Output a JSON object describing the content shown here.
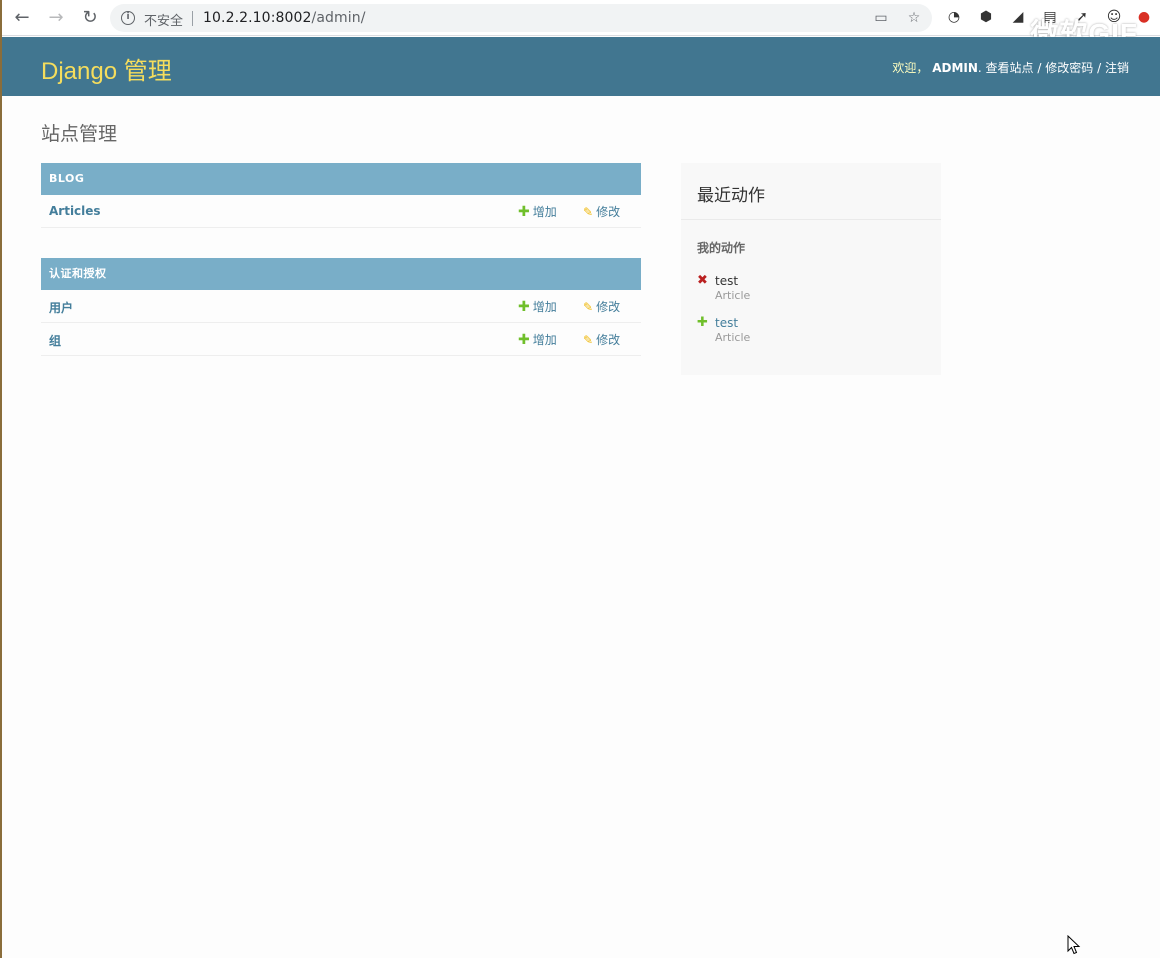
{
  "browser": {
    "security_label": "不安全",
    "url_host": "10.2.2.10:8002",
    "url_path": "/admin/",
    "watermark": "微软GIF"
  },
  "header": {
    "branding": "Django 管理",
    "welcome": "欢迎，",
    "username": "ADMIN",
    "view_site": "查看站点",
    "change_password": "修改密码",
    "logout": "注销",
    "separator": "/"
  },
  "page_title": "站点管理",
  "modules": [
    {
      "caption": "BLOG",
      "rows": [
        {
          "name": "Articles",
          "add": "增加",
          "change": "修改"
        }
      ]
    },
    {
      "caption": "认证和授权",
      "rows": [
        {
          "name": "用户",
          "add": "增加",
          "change": "修改"
        },
        {
          "name": "组",
          "add": "增加",
          "change": "修改"
        }
      ]
    }
  ],
  "recent_actions": {
    "title": "最近动作",
    "subtitle": "我的动作",
    "items": [
      {
        "icon": "delete-icon",
        "name": "test",
        "type": "Article"
      },
      {
        "icon": "add-icon",
        "name": "test",
        "type": "Article"
      }
    ]
  },
  "colors": {
    "header_bg": "#417690",
    "branding": "#f5dd5d",
    "caption_bg": "#79aec8",
    "link": "#447e9b",
    "add_green": "#70bf2b",
    "delete_red": "#ba2121",
    "change_yellow": "#efb80b"
  }
}
